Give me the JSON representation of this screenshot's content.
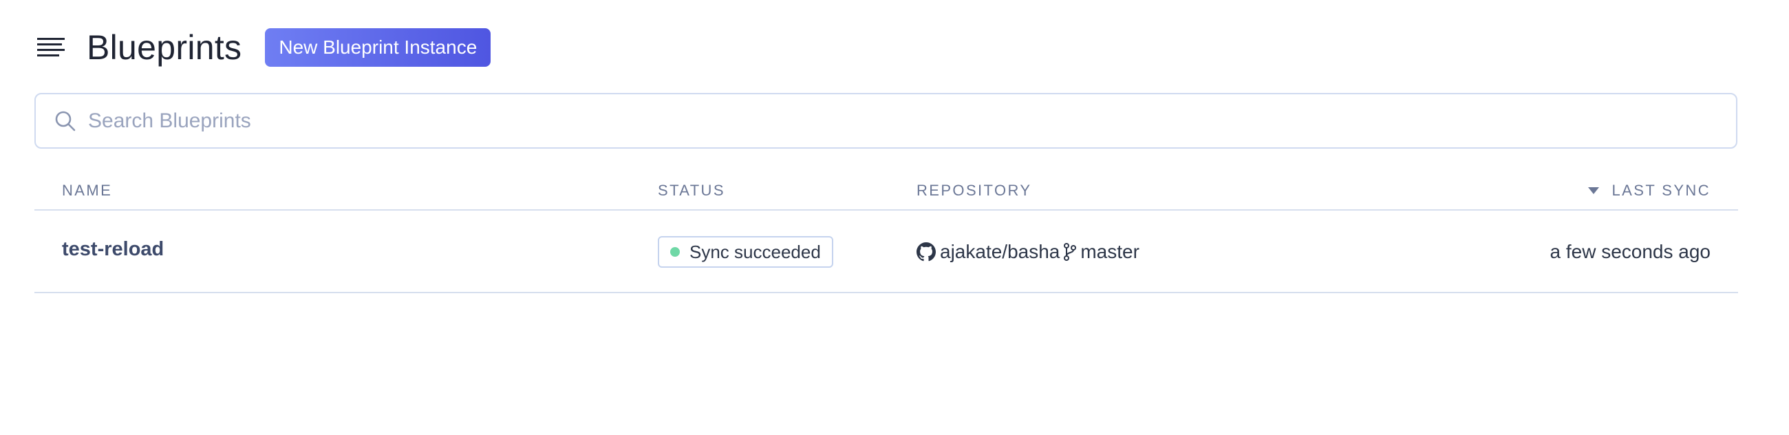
{
  "header": {
    "menu_icon": "menu-lines-icon",
    "title": "Blueprints",
    "new_button_label": "New Blueprint Instance",
    "button_gradient": [
      "#6f7ef3",
      "#4f56e1"
    ]
  },
  "search": {
    "icon": "search-icon",
    "placeholder": "Search Blueprints",
    "value": ""
  },
  "table": {
    "columns": {
      "name": "NAME",
      "status": "STATUS",
      "repository": "REPOSITORY",
      "last_sync": "LAST SYNC"
    },
    "sort_icon": "caret-down-icon",
    "rows": [
      {
        "name": "test-reload",
        "status": "Sync succeeded",
        "status_color": "#6fd8a6",
        "repo_icon": "github-icon",
        "repo": "ajakate/basha",
        "branch_icon": "git-branch-icon",
        "branch": "master",
        "last_sync": "a few seconds ago"
      }
    ]
  }
}
